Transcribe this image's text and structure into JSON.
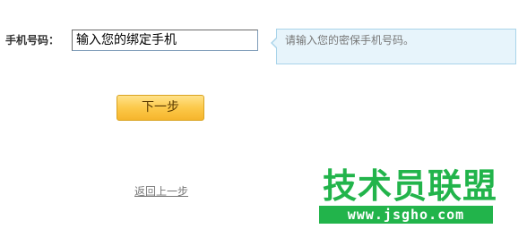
{
  "form": {
    "phone_label": "手机号码：",
    "phone_value": "输入您的绑定手机",
    "tip_text": "请输入您的密保手机号码。"
  },
  "actions": {
    "next_label": "下一步",
    "back_label": "返回上一步"
  },
  "watermark": {
    "site_name": "技术员联盟",
    "site_url": "www.jsgho.com"
  },
  "colors": {
    "button_gradient_top": "#ffe28a",
    "button_gradient_bottom": "#f6b52c",
    "tip_background": "#e7f4fb",
    "tip_border": "#a9d4ea",
    "watermark_green": "#22b44b"
  }
}
